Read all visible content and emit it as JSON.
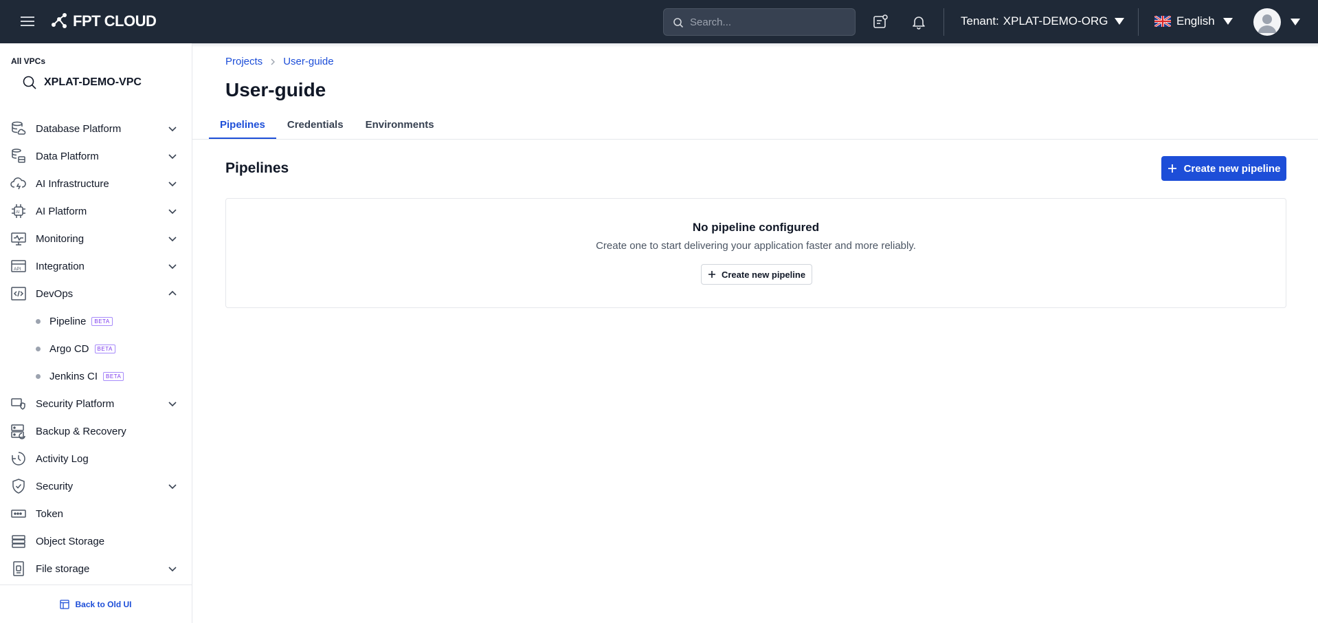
{
  "header": {
    "logo_text": "FPT CLOUD",
    "search_placeholder": "Search...",
    "tenant_label": "Tenant:",
    "tenant_value": "XPLAT-DEMO-ORG",
    "language": "English"
  },
  "sidebar": {
    "vpc_label": "All VPCs",
    "vpc_name": "XPLAT-DEMO-VPC",
    "items": [
      {
        "label": "Database Platform",
        "icon": "database-cloud-icon",
        "expandable": true,
        "expanded": false
      },
      {
        "label": "Data Platform",
        "icon": "data-platform-icon",
        "expandable": true,
        "expanded": false
      },
      {
        "label": "AI Infrastructure",
        "icon": "ai-cloud-icon",
        "expandable": true,
        "expanded": false
      },
      {
        "label": "AI Platform",
        "icon": "ai-chip-icon",
        "expandable": true,
        "expanded": false
      },
      {
        "label": "Monitoring",
        "icon": "monitor-pulse-icon",
        "expandable": true,
        "expanded": false
      },
      {
        "label": "Integration",
        "icon": "api-icon",
        "expandable": true,
        "expanded": false
      },
      {
        "label": "DevOps",
        "icon": "devops-code-icon",
        "expandable": true,
        "expanded": true
      }
    ],
    "devops_children": [
      {
        "label": "Pipeline",
        "badge": "BETA"
      },
      {
        "label": "Argo CD",
        "badge": "BETA"
      },
      {
        "label": "Jenkins CI",
        "badge": "BETA"
      }
    ],
    "items_after": [
      {
        "label": "Security Platform",
        "icon": "security-platform-icon",
        "expandable": true
      },
      {
        "label": "Backup & Recovery",
        "icon": "backup-icon",
        "expandable": false
      },
      {
        "label": "Activity Log",
        "icon": "clock-icon",
        "expandable": false
      },
      {
        "label": "Security",
        "icon": "shield-check-icon",
        "expandable": true
      },
      {
        "label": "Token",
        "icon": "token-icon",
        "expandable": false
      },
      {
        "label": "Object Storage",
        "icon": "object-storage-icon",
        "expandable": false
      },
      {
        "label": "File storage",
        "icon": "file-storage-icon",
        "expandable": true
      }
    ],
    "footer_label": "Back to Old UI"
  },
  "main": {
    "breadcrumb": [
      "Projects",
      "User-guide"
    ],
    "title": "User-guide",
    "tabs": [
      {
        "label": "Pipelines",
        "active": true
      },
      {
        "label": "Credentials",
        "active": false
      },
      {
        "label": "Environments",
        "active": false
      }
    ],
    "section_title": "Pipelines",
    "create_button": "Create new pipeline",
    "empty": {
      "title": "No pipeline configured",
      "description": "Create one to start delivering your application faster and more reliably.",
      "button": "Create new pipeline"
    }
  },
  "colors": {
    "topbar": "#1f2937",
    "accent": "#1d4ed8",
    "beta": "#7c3aed"
  }
}
